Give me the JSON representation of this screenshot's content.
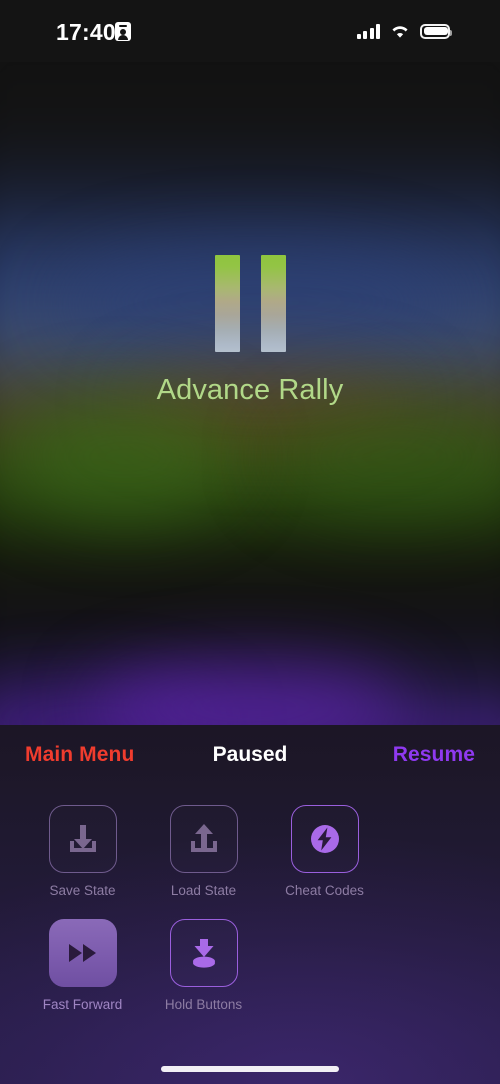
{
  "status_bar": {
    "time": "17:40",
    "badge_icon": "id-card-icon",
    "cellular_icon": "cellular-signal-icon",
    "wifi_icon": "wifi-icon",
    "battery_icon": "battery-icon"
  },
  "game": {
    "title": "Advance Rally",
    "pause_glyph": "pause-icon",
    "title_color": "#b1d888",
    "pause_bar_gradient_top": "#8fc53e",
    "pause_bar_gradient_bottom": "#b4c0cd"
  },
  "panel": {
    "left_action": "Main Menu",
    "left_action_color": "#f03c2e",
    "status": "Paused",
    "status_color": "#ffffff",
    "right_action": "Resume",
    "right_action_color": "#8f39f0",
    "items": [
      {
        "label": "Save State",
        "icon": "save-state-icon",
        "state": "normal"
      },
      {
        "label": "Load State",
        "icon": "load-state-icon",
        "state": "normal"
      },
      {
        "label": "Cheat Codes",
        "icon": "cheat-codes-icon",
        "state": "highlighted"
      },
      {
        "label": "Fast Forward",
        "icon": "fast-forward-icon",
        "state": "active"
      },
      {
        "label": "Hold Buttons",
        "icon": "hold-buttons-icon",
        "state": "highlighted"
      }
    ]
  },
  "home_indicator": {
    "name": "home-indicator"
  }
}
